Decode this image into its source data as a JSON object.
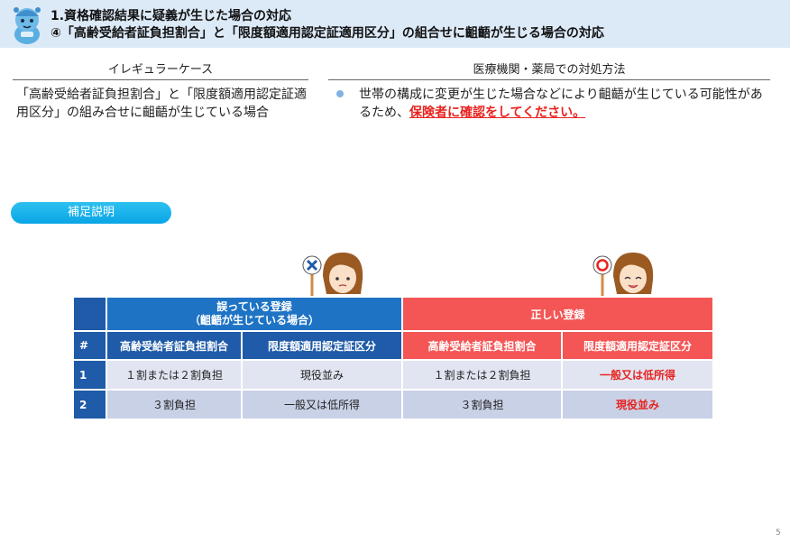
{
  "header": {
    "title_line1": "1.資格確認結果に疑義が生じた場合の対応",
    "title_line2": "④「高齢受給者証負担割合」と「限度額適用認定証適用区分」の組合せに齟齬が生じる場合の対応"
  },
  "columns": {
    "left_heading": "イレギュラーケース",
    "right_heading": "医療機関・薬局での対処方法"
  },
  "case": {
    "text": "「高齢受給者証負担割合」と「限度額適用認定証適用区分」の組み合せに齟齬が生じている場合"
  },
  "measure": {
    "text_before": "世帯の構成に変更が生じた場合などにより齟齬が生じている可能性があるため、",
    "text_emphasis": "保険者に確認をしてください。"
  },
  "supplement_label": "補足説明",
  "table": {
    "wrong_group_line1": "誤っている登録",
    "wrong_group_line2": "（齟齬が生じている場合）",
    "right_group": "正しい登録",
    "number_header": "#",
    "col_ratio": "高齢受給者証負担割合",
    "col_category": "限度額適用認定証区分",
    "rows": [
      {
        "num": "1",
        "wrong_ratio": "１割または２割負担",
        "wrong_category": "現役並み",
        "right_ratio": "１割または２割負担",
        "right_category": "一般又は低所得"
      },
      {
        "num": "2",
        "wrong_ratio": "３割負担",
        "wrong_category": "一般又は低所得",
        "right_ratio": "３割負担",
        "right_category": "現役並み"
      }
    ]
  },
  "page_number": "5",
  "colors": {
    "header_bg": "#dce9f7",
    "wrong_blue": "#1f5ba8",
    "right_red": "#f45656",
    "emphasis_red": "#e8231f",
    "pill_blue": "#0aa5e6"
  },
  "icons": [
    "mascot-icon",
    "doctor-cross-sign-icon",
    "doctor-circle-sign-icon"
  ]
}
